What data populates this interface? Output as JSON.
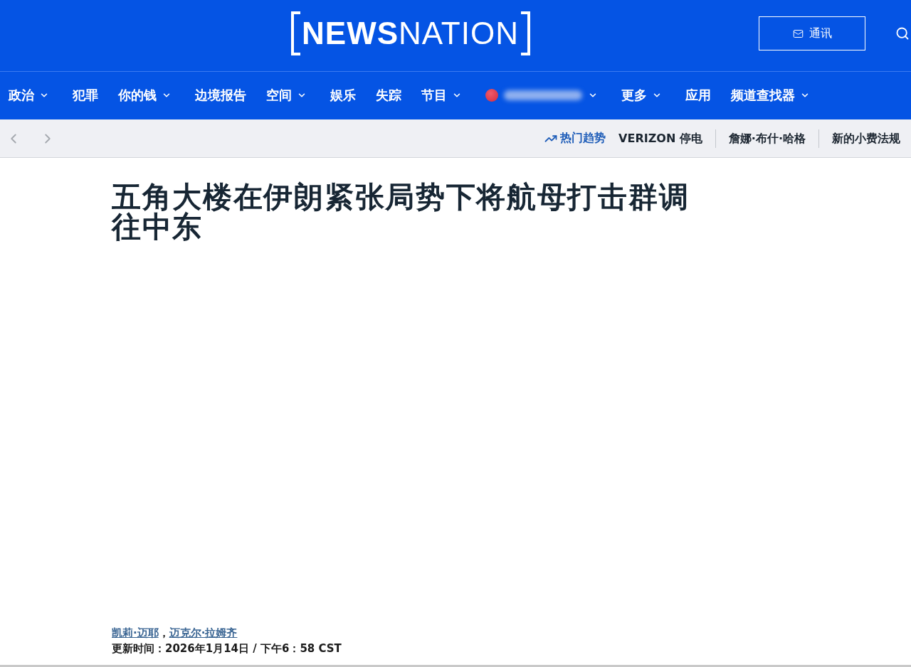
{
  "header": {
    "logo": "**NEWS**NATION",
    "newsletter_button": "通讯"
  },
  "nav": {
    "items": [
      {
        "kind": "link",
        "label": "政治",
        "dropdown": true
      },
      {
        "kind": "link",
        "label": "犯罪",
        "dropdown": false
      },
      {
        "kind": "link",
        "label": "你的钱",
        "dropdown": true
      },
      {
        "kind": "link",
        "label": "边境报告",
        "dropdown": false
      },
      {
        "kind": "link",
        "label": "空间",
        "dropdown": true
      },
      {
        "kind": "link",
        "label": "娱乐",
        "dropdown": false
      },
      {
        "kind": "link",
        "label": "失踪",
        "dropdown": false
      },
      {
        "kind": "link",
        "label": "节目",
        "dropdown": true
      },
      {
        "kind": "blurred",
        "dropdown": true
      },
      {
        "kind": "link",
        "label": "更多",
        "dropdown": true
      },
      {
        "kind": "link",
        "label": "应用",
        "dropdown": false
      },
      {
        "kind": "link",
        "label": "频道查找器",
        "dropdown": true
      }
    ]
  },
  "subnav": {
    "trending_label": "热门趋势",
    "topics": [
      "VERIZON 停电",
      "詹娜·布什·哈格",
      "新的小费法规"
    ]
  },
  "article": {
    "headline": "五角大楼在伊朗紧张局势下将航母打击群调往中东",
    "authors": [
      "凯莉·迈耶",
      "迈克尔·拉姆齐"
    ],
    "author_separator": "，",
    "updated": "更新时间：2026年1月14日 / 下午6：58 CST"
  }
}
